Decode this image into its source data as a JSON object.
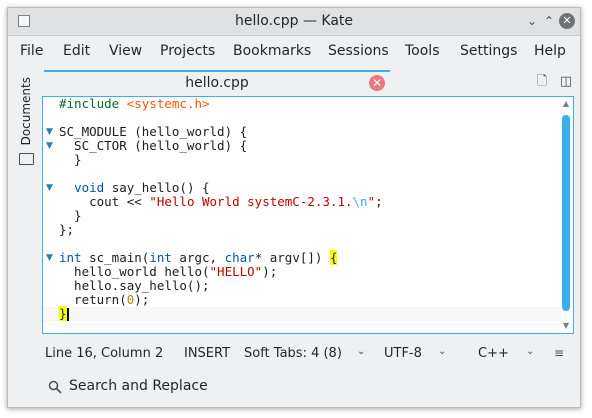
{
  "window": {
    "title": "hello.cpp  — Kate",
    "controls": {
      "minimize": "⌄",
      "maximize": "⌃",
      "close": "✕"
    }
  },
  "menu": [
    "File",
    "Edit",
    "View",
    "Projects",
    "Bookmarks",
    "Sessions",
    "Tools",
    "Settings",
    "Help"
  ],
  "sidebar": {
    "documents_label": "Documents"
  },
  "tabs": [
    {
      "label": "hello.cpp",
      "active": true
    }
  ],
  "editor": {
    "code_lines": [
      "#include <systemc.h>",
      "",
      "SC_MODULE (hello_world) {",
      "  SC_CTOR (hello_world) {",
      "  }",
      "",
      "  void say_hello() {",
      "    cout << \"Hello World systemC-2.3.1.\\n\";",
      "  }",
      "};",
      "",
      "int sc_main(int argc, char* argv[]) {",
      "  hello_world hello(\"HELLO\");",
      "  hello.say_hello();",
      "  return(0);",
      "}"
    ],
    "fold_markers_lines": [
      3,
      4,
      7,
      12
    ]
  },
  "status": {
    "position": "Line 16, Column 2",
    "mode": "INSERT",
    "indent": "Soft Tabs: 4 (8)",
    "encoding": "UTF-8",
    "language": "C++"
  },
  "findbar": {
    "label": "Search and Replace"
  },
  "colors": {
    "accent": "#3daee9",
    "tab_close": "#e8797d",
    "string": "#bf0303",
    "preprocessor": "#006e28",
    "include_path": "#ff5500",
    "type": "#0057ae",
    "number": "#b08000",
    "bracket_highlight": "#ffff00"
  }
}
